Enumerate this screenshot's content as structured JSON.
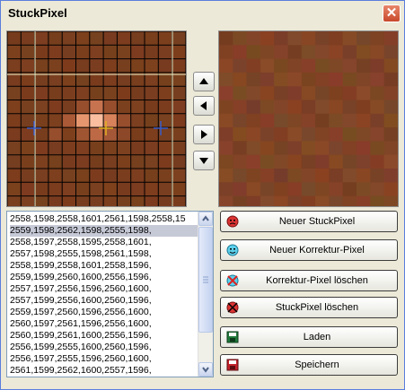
{
  "window": {
    "title": "StuckPixel",
    "close_symbol": "✕"
  },
  "nav": {
    "up_icon": "arrow-up-icon",
    "left_icon": "arrow-left-icon",
    "right_icon": "arrow-right-icon",
    "down_icon": "arrow-down-icon"
  },
  "list": {
    "selected_index": 1,
    "items": [
      "2558,1598,2558,1601,2561,1598,2558,15",
      "2559,1598,2562,1598,2555,1598,",
      "2558,1597,2558,1595,2558,1601,",
      "2557,1598,2555,1598,2561,1598,",
      "2558,1599,2558,1601,2558,1596,",
      "2559,1599,2560,1600,2556,1596,",
      "2557,1597,2556,1596,2560,1600,",
      "2557,1599,2556,1600,2560,1596,",
      "2559,1597,2560,1596,2556,1600,",
      "2560,1597,2561,1596,2556,1600,",
      "2560,1599,2561,1600,2556,1596,",
      "2556,1599,2555,1600,2560,1596,",
      "2556,1597,2555,1596,2560,1600,",
      "2561,1599,2562,1600,2557,1596,"
    ]
  },
  "buttons": {
    "new_stuck": "Neuer StuckPixel",
    "new_correction": "Neuer Korrektur-Pixel",
    "delete_correction": "Korrektur-Pixel löschen",
    "delete_stuck": "StuckPixel löschen",
    "load": "Laden",
    "save": "Speichern"
  },
  "colors": {
    "accent_red": "#cc2222",
    "accent_cyan": "#33c3e0",
    "save_green": "#1f7a3a",
    "grid_base": "#7a3e1e"
  }
}
